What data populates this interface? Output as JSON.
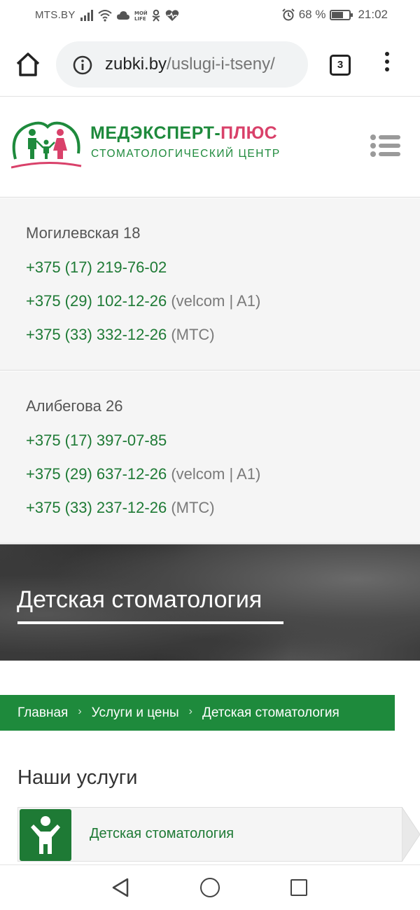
{
  "status_bar": {
    "carrier": "MTS.BY",
    "battery_percent": "68 %",
    "battery_level": 0.68,
    "time": "21:02",
    "icons": [
      "signal-icon",
      "wifi-icon",
      "cloud-icon",
      "mts-life-icon",
      "odnoklassniki-icon",
      "heart-pulse-icon",
      "alarm-icon",
      "battery-icon"
    ]
  },
  "browser": {
    "url_host": "zubki.by",
    "url_path": "/uslugi-i-tseny/",
    "tab_count": "3"
  },
  "brand": {
    "title_green": "МЕДЭКСПЕРТ-",
    "title_pink": "ПЛЮС",
    "subtitle": "СТОМАТОЛОГИЧЕСКИЙ ЦЕНТР",
    "colors": {
      "green": "#1e8a3c",
      "pink": "#d9416a"
    }
  },
  "contacts": [
    {
      "address": "Могилевская 18",
      "phones": [
        {
          "number": "+375 (17) 219-76-02",
          "note": ""
        },
        {
          "number": "+375 (29) 102-12-26",
          "note": " (velcom | A1)"
        },
        {
          "number": "+375 (33) 332-12-26",
          "note": " (МТС)"
        }
      ]
    },
    {
      "address": "Алибегова 26",
      "phones": [
        {
          "number": "+375 (17) 397-07-85",
          "note": ""
        },
        {
          "number": "+375 (29) 637-12-26",
          "note": " (velcom | A1)"
        },
        {
          "number": "+375 (33) 237-12-26",
          "note": " (МТС)"
        }
      ]
    }
  ],
  "hero": {
    "title": "Детская стоматология"
  },
  "breadcrumb": {
    "items": [
      "Главная",
      "Услуги и цены",
      "Детская стоматология"
    ],
    "separator": "›"
  },
  "services": {
    "title": "Наши услуги",
    "items": [
      {
        "label": "Детская стоматология",
        "icon": "child-icon"
      }
    ]
  }
}
